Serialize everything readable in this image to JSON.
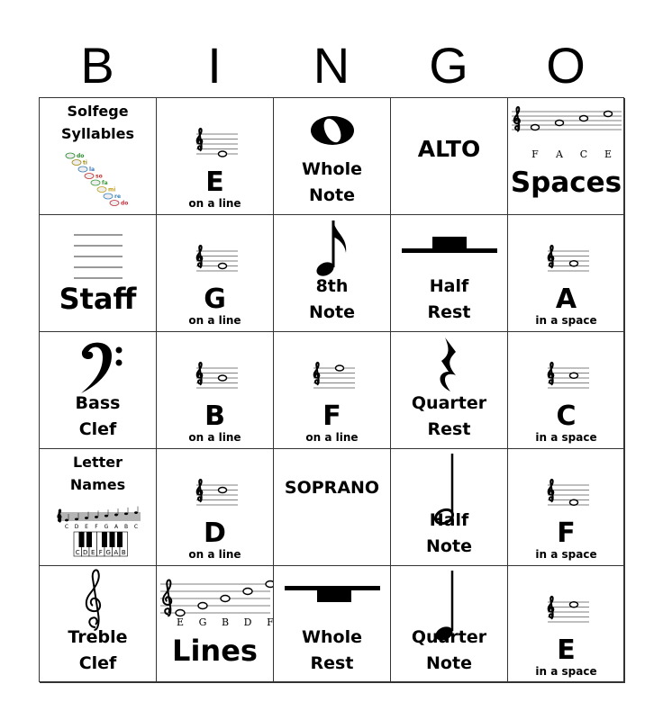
{
  "header": [
    "B",
    "I",
    "N",
    "G",
    "O"
  ],
  "cells": [
    {
      "kind": "solfege",
      "lines": [
        "Solfege",
        "Syllables"
      ],
      "art_text": [
        "do",
        "ti",
        "la",
        "so",
        "fa",
        "mi",
        "re",
        "do"
      ]
    },
    {
      "kind": "note",
      "pitch": 0,
      "big": "E",
      "caption": "on a line"
    },
    {
      "kind": "icon",
      "icon": "whole-note",
      "lines": [
        "Whole",
        "Note"
      ]
    },
    {
      "kind": "word",
      "word": "ALTO",
      "size": 25
    },
    {
      "kind": "spaces",
      "letters": [
        "F",
        "A",
        "C",
        "E"
      ],
      "big": "Spaces"
    },
    {
      "kind": "staff",
      "big": "Staff"
    },
    {
      "kind": "note",
      "pitch": 2,
      "big": "G",
      "caption": "on a line"
    },
    {
      "kind": "icon",
      "icon": "eighth-note",
      "lines": [
        "8th",
        "Note"
      ]
    },
    {
      "kind": "icon",
      "icon": "half-rest",
      "lines": [
        "Half",
        "Rest"
      ]
    },
    {
      "kind": "note",
      "pitch": 3,
      "big": "A",
      "caption": "in a space"
    },
    {
      "kind": "icon",
      "icon": "bass-clef",
      "lines": [
        "Bass",
        "Clef"
      ]
    },
    {
      "kind": "note",
      "pitch": 4,
      "big": "B",
      "caption": "on a line"
    },
    {
      "kind": "note",
      "pitch": 8,
      "big": "F",
      "caption": "on a line"
    },
    {
      "kind": "icon",
      "icon": "quarter-rest",
      "lines": [
        "Quarter",
        "Rest"
      ]
    },
    {
      "kind": "note",
      "pitch": 5,
      "big": "C",
      "caption": "in a space"
    },
    {
      "kind": "letters",
      "lines": [
        "Letter",
        "Names"
      ],
      "notes": [
        "C",
        "D",
        "E",
        "F",
        "G",
        "A",
        "B",
        "C"
      ],
      "keys": [
        "C",
        "D",
        "E",
        "F",
        "G",
        "A",
        "B"
      ]
    },
    {
      "kind": "note",
      "pitch": 6,
      "big": "D",
      "caption": "on a line"
    },
    {
      "kind": "word",
      "word": "SOPRANO",
      "size": 19
    },
    {
      "kind": "icon",
      "icon": "half-note",
      "lines": [
        "Half",
        "Note"
      ]
    },
    {
      "kind": "note",
      "pitch": 1,
      "big": "F",
      "caption": "in a space"
    },
    {
      "kind": "icon",
      "icon": "treble-clef",
      "lines": [
        "Treble",
        "Clef"
      ]
    },
    {
      "kind": "lines",
      "letters": [
        "E",
        "G",
        "B",
        "D",
        "F"
      ],
      "big": "Lines"
    },
    {
      "kind": "icon",
      "icon": "whole-rest",
      "lines": [
        "Whole",
        "Rest"
      ]
    },
    {
      "kind": "icon",
      "icon": "quarter-note",
      "lines": [
        "Quarter",
        "Note"
      ]
    },
    {
      "kind": "note",
      "pitch": 7,
      "big": "E",
      "caption": "in a space"
    }
  ]
}
